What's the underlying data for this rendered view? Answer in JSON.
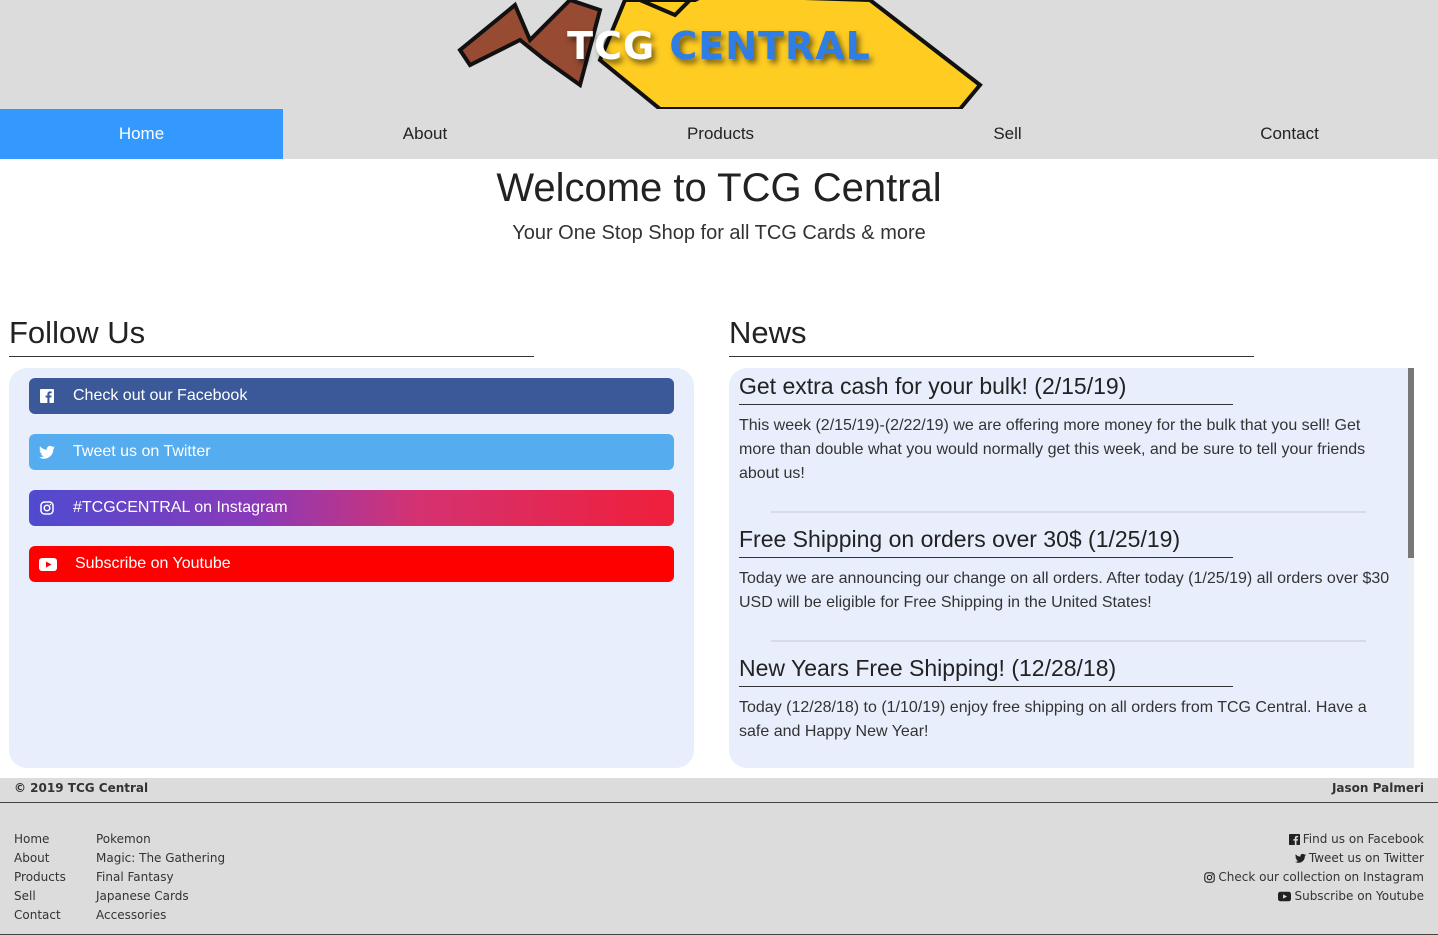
{
  "header": {
    "logo_text_part1": "TCG",
    "logo_text_part2": "CENTRAL"
  },
  "nav": {
    "items": [
      {
        "label": "Home",
        "active": true
      },
      {
        "label": "About",
        "active": false
      },
      {
        "label": "Products",
        "active": false
      },
      {
        "label": "Sell",
        "active": false
      },
      {
        "label": "Contact",
        "active": false
      }
    ]
  },
  "hero": {
    "title": "Welcome to TCG Central",
    "subtitle": "Your One Stop Shop for all TCG Cards & more"
  },
  "follow": {
    "title": "Follow Us",
    "buttons": [
      {
        "label": "Check out our Facebook",
        "icon": "facebook-icon",
        "color": "#3b5998"
      },
      {
        "label": "Tweet us on Twitter",
        "icon": "twitter-icon",
        "color": "#55acee"
      },
      {
        "label": "#TCGCENTRAL on Instagram",
        "icon": "instagram-icon",
        "color": "#8a3ab9"
      },
      {
        "label": "Subscribe on Youtube",
        "icon": "youtube-icon",
        "color": "#ff0000"
      }
    ]
  },
  "news": {
    "title": "News",
    "items": [
      {
        "title": "Get extra cash for your bulk! (2/15/19)",
        "body": "This week (2/15/19)-(2/22/19) we are offering more money for the bulk that you sell! Get more than double what you would normally get this week, and be sure to tell your friends about us!"
      },
      {
        "title": "Free Shipping on orders over 30$ (1/25/19)",
        "body": "Today we are announcing our change on all orders. After today (1/25/19) all orders over $30 USD will be eligible for Free Shipping in the United States!"
      },
      {
        "title": "New Years Free Shipping! (12/28/18)",
        "body": "Today (12/28/18) to (1/10/19) enjoy free shipping on all orders from TCG Central. Have a safe and Happy New Year!"
      }
    ]
  },
  "footer": {
    "copyright": "© 2019 TCG Central",
    "author": "Jason Palmeri",
    "nav_links": [
      "Home",
      "About",
      "Products",
      "Sell",
      "Contact"
    ],
    "product_links": [
      "Pokemon",
      "Magic: The Gathering",
      "Final Fantasy",
      "Japanese Cards",
      "Accessories"
    ],
    "social_links": [
      {
        "label": "Find us on Facebook",
        "icon": "facebook-icon"
      },
      {
        "label": "Tweet us on Twitter",
        "icon": "twitter-icon"
      },
      {
        "label": "Check our collection on Instagram",
        "icon": "instagram-icon"
      },
      {
        "label": "Subscribe on Youtube",
        "icon": "youtube-icon"
      }
    ]
  },
  "colors": {
    "accent": "#3399ff",
    "header_bg": "#dcdcdc",
    "panel_bg": "#e8eefc",
    "logo_yellow": "#ffcc22",
    "logo_brown": "#964b32"
  }
}
